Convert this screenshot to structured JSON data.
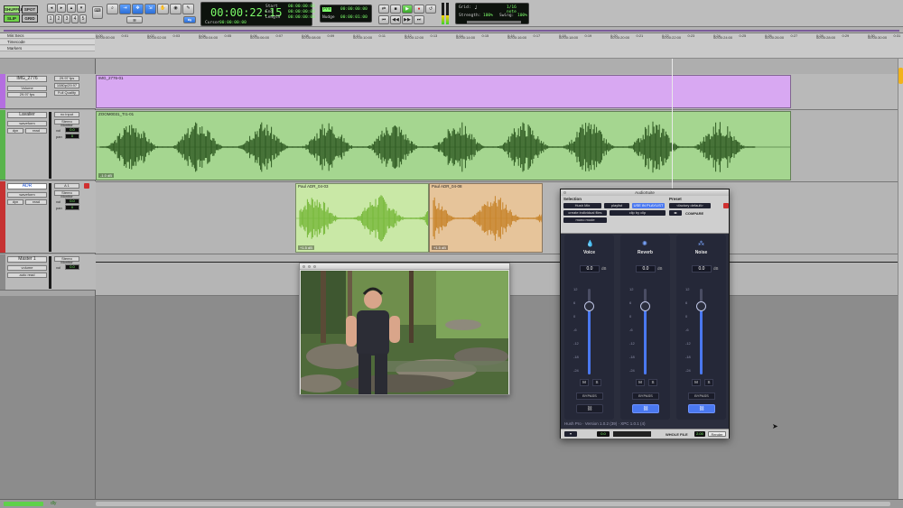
{
  "toolbar": {
    "modes": [
      "SHUFFLE",
      "SPOT",
      "SLIP",
      "GRID"
    ],
    "counter": "00:00:22:15",
    "selection": {
      "start_label": "Start",
      "start": "00:00:00:00",
      "end_label": "End",
      "end": "00:00:00:00",
      "length_label": "Length",
      "length": "00:00:00:00"
    },
    "cursor_label": "Cursor",
    "cursor_value": "00:00:00:00",
    "preroll_label": "Pre",
    "postroll_label": "Post",
    "preroll_value": "00:00:00:00",
    "postroll_value": "00:00:01:00",
    "nudge_label": "Nudge",
    "nudge_value": "00:00:01:00",
    "grid_label": "Grid:",
    "grid_value": "1/16 note",
    "strength_label": "Strength:",
    "strength_value": "100%",
    "swing_label": "Swing:",
    "swing_value": "100%"
  },
  "rulers": {
    "min_secs": "Min:Secs",
    "timecode": "Timecode",
    "markers": "Markers",
    "seconds_ticks": [
      "0:00",
      "0:01",
      "0:02",
      "0:03",
      "0:04",
      "0:05",
      "0:06",
      "0:07",
      "0:08",
      "0:09",
      "0:10",
      "0:11",
      "0:12",
      "0:13",
      "0:14",
      "0:15",
      "0:16",
      "0:17",
      "0:18",
      "0:19",
      "0:20",
      "0:21",
      "0:22",
      "0:23",
      "0:24",
      "0:25",
      "0:26",
      "0:27",
      "0:28",
      "0:29",
      "0:30",
      "0:31"
    ],
    "timecode_ticks": [
      "00:00:00:00",
      "00:00:02:00",
      "00:00:04:00",
      "00:00:06:00",
      "00:00:08:00",
      "00:00:10:00",
      "00:00:12:00",
      "00:00:14:00",
      "00:00:16:00",
      "00:00:18:00",
      "00:00:20:00",
      "00:00:22:00",
      "00:00:24:00",
      "00:00:26:00",
      "00:00:28:00",
      "00:00:30:00"
    ]
  },
  "tracks": [
    {
      "name": "IMG_2776",
      "color": "#b46ee0",
      "sub1": "Volume",
      "sub2": "29.97 fps",
      "sub3": "Full Quality",
      "io1": "29.97 fps",
      "io2": "1080p/29.97"
    },
    {
      "name": "Lavalier",
      "color": "#59b44c",
      "sub1": "waveform",
      "sub2": "dyn",
      "sub3": "read",
      "io1": "no input",
      "io2": "Stereo Monitor",
      "vol_label": "vol",
      "vol": "0.0",
      "pan_label": "pan",
      "pan": "0"
    },
    {
      "name": "ADR",
      "color": "#c63232",
      "sub1": "waveform",
      "sub2": "dyn",
      "sub3": "read",
      "io1": "A 1",
      "io2": "Stereo Monitor",
      "vol_label": "vol",
      "vol": "0.0",
      "pan_label": "pan",
      "pan": "0"
    },
    {
      "name": "Master 1",
      "color": "#8a8a8a",
      "sub1": "volume",
      "sub2": "auto read",
      "io1": "Stereo Monitor",
      "vol_label": "vol",
      "vol": "0.0"
    }
  ],
  "clips": {
    "video": "IMG_2776-01",
    "lav": "ZOOM0031_Tr1-01",
    "adr1": "Paul ADR_04-03",
    "adr2": "Paul ADR_04-08",
    "lav_badge": "-1.0 dB",
    "adr1_badge": "+1.5 dB",
    "adr2_badge": "+1.5 dB"
  },
  "plugin": {
    "title": "AudioSuite",
    "selection_label": "Selection",
    "preset_label": "Preset",
    "plugin_name": "Hush Mix",
    "playlist": "playlist",
    "use_in_playlist": "USE IN PLAYLIST",
    "preset_value": "<factory default>",
    "create_files": "create individual files",
    "clip_by_clip": "clip by clip",
    "compare": "COMPARE",
    "mono_mode": "mono mode",
    "strips": [
      {
        "name": "Voice",
        "value": "0.0",
        "unit": "dB",
        "link_on": false
      },
      {
        "name": "Reverb",
        "value": "0.0",
        "unit": "dB",
        "link_on": true
      },
      {
        "name": "Noise",
        "value": "0.0",
        "unit": "dB",
        "link_on": true
      }
    ],
    "scale": [
      "12",
      "6",
      "0",
      "-6",
      "-12",
      "-18",
      "-24"
    ],
    "m_label": "M",
    "s_label": "S",
    "bypass_label": "BYPASS",
    "footer": "Hush Pro · Version 1.0.2 (39) · XPC 1.0.1 (4)",
    "handle_value": "0.0",
    "whole_file": "WHOLE FILE",
    "handle_secs": "2.00",
    "render": "Render"
  },
  "status": {
    "label": "dly"
  }
}
